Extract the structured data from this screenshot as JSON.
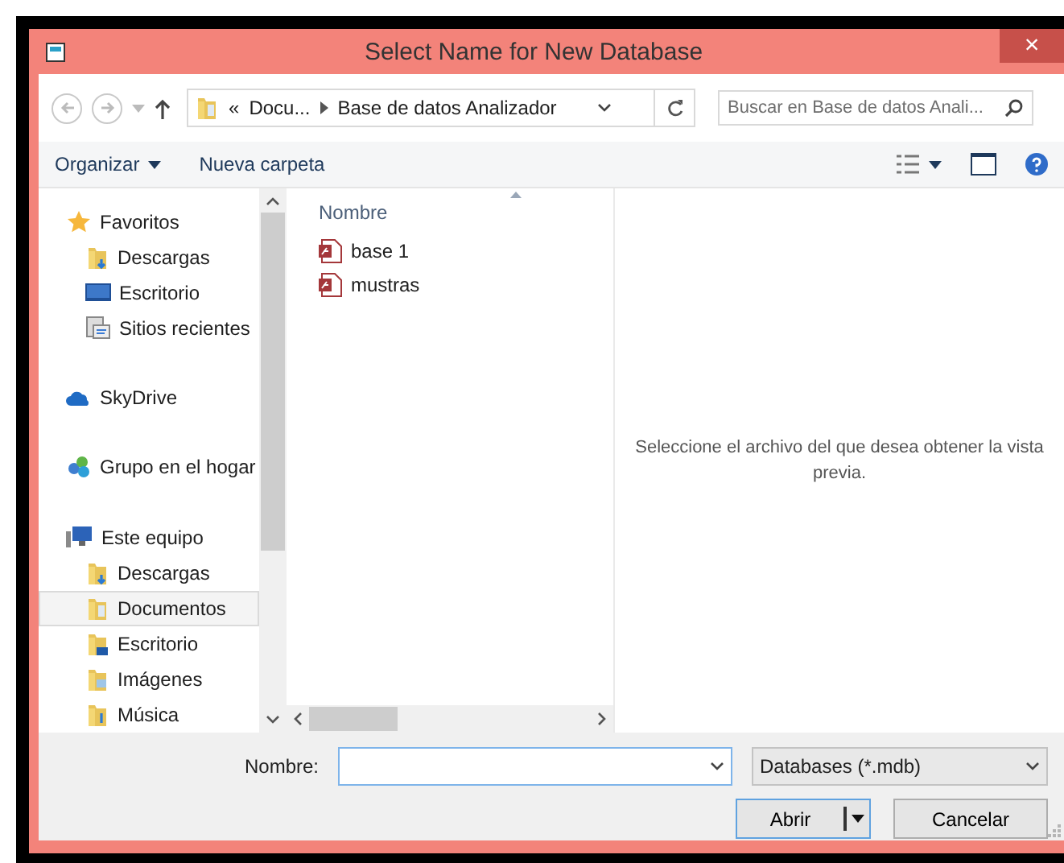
{
  "window": {
    "title": "Select Name for New Database",
    "close": "×"
  },
  "address": {
    "overflow": "«",
    "crumbs": [
      "Docu...",
      "Base de datos Analizador"
    ]
  },
  "search": {
    "placeholder": "Buscar en Base de datos Anali..."
  },
  "commands": [
    {
      "label": "Organizar",
      "kind": "menu"
    },
    {
      "label": "Nueva carpeta",
      "kind": "plain"
    }
  ],
  "sidebar": {
    "groups": [
      {
        "label": "Favoritos",
        "kind": "star",
        "selected": false,
        "children": [
          {
            "label": "Descargas",
            "kind": "downloads",
            "selected": false
          },
          {
            "label": "Escritorio",
            "kind": "desktop",
            "selected": false
          },
          {
            "label": "Sitios recientes",
            "kind": "recent",
            "selected": false
          }
        ]
      },
      {
        "label": "SkyDrive",
        "kind": "cloud",
        "selected": false
      },
      {
        "label": "Grupo en el hogar",
        "kind": "homegroup",
        "selected": false
      },
      {
        "label": "Este equipo",
        "kind": "computer",
        "selected": false,
        "children": [
          {
            "label": "Descargas",
            "kind": "downloads",
            "selected": false
          },
          {
            "label": "Documentos",
            "kind": "documents",
            "selected": true
          },
          {
            "label": "Escritorio",
            "kind": "desktop-folder",
            "selected": false
          },
          {
            "label": "Imágenes",
            "kind": "pictures",
            "selected": false
          },
          {
            "label": "Música",
            "kind": "music",
            "selected": false
          }
        ]
      }
    ]
  },
  "files": {
    "column": "Nombre",
    "items": [
      {
        "name": "base 1"
      },
      {
        "name": "mustras"
      }
    ]
  },
  "preview": {
    "message": "Seleccione el archivo del que desea obtener la vista previa."
  },
  "footer": {
    "name_label": "Nombre:",
    "file_type": "Databases (*.mdb)",
    "buttons": [
      {
        "label": "Abrir",
        "kind": "split"
      },
      {
        "label": "Cancelar",
        "kind": "plain"
      }
    ]
  }
}
